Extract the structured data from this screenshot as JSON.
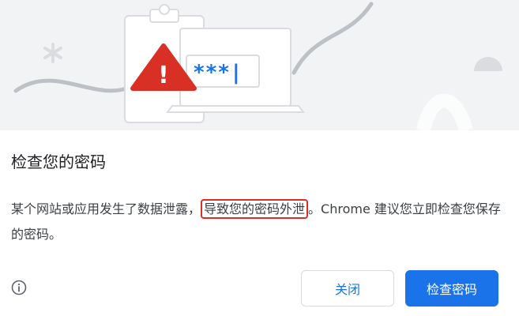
{
  "illustration": {
    "password_mask": "***|",
    "warning_symbol": "!",
    "icons": [
      "clipboard-icon",
      "laptop-icon",
      "warning-triangle-icon",
      "asterisk-icon"
    ]
  },
  "dialog": {
    "title": "检查您的密码",
    "body_before": "某个网站或应用发生了数据泄露，",
    "body_highlight": "导致您的密码外泄",
    "body_after": "。Chrome 建议您立即检查您保存的密码。"
  },
  "buttons": {
    "close_label": "关闭",
    "check_label": "检查密码"
  },
  "colors": {
    "accent": "#1a73e8",
    "warning": "#d93025",
    "hero_bg": "#f1f3f4"
  }
}
